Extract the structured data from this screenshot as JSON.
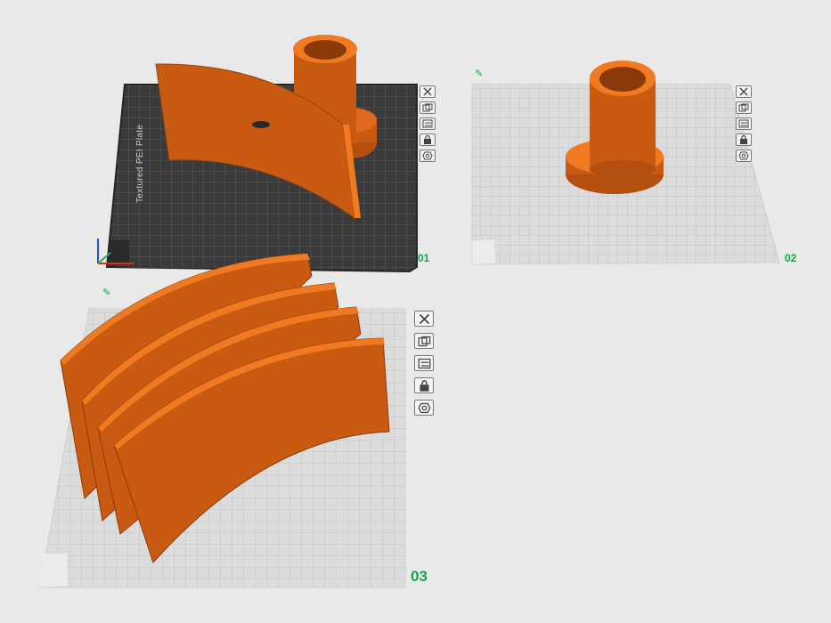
{
  "plates": [
    {
      "number": "01",
      "label": "Textured PEI Plate",
      "selected": true
    },
    {
      "number": "02",
      "label": "",
      "selected": false
    },
    {
      "number": "03",
      "label": "",
      "selected": false
    }
  ],
  "plate_tools": [
    {
      "icon": "close-icon"
    },
    {
      "icon": "arrange-icon"
    },
    {
      "icon": "orient-icon"
    },
    {
      "icon": "lock-icon"
    },
    {
      "icon": "settings-icon"
    }
  ],
  "colors": {
    "part": "#c85a12",
    "part_top": "#f07a22",
    "plate_dark": "#3c3c3c",
    "plate_light": "#d6d6d6",
    "accent": "#12a84a"
  },
  "edit_icon": "✎"
}
